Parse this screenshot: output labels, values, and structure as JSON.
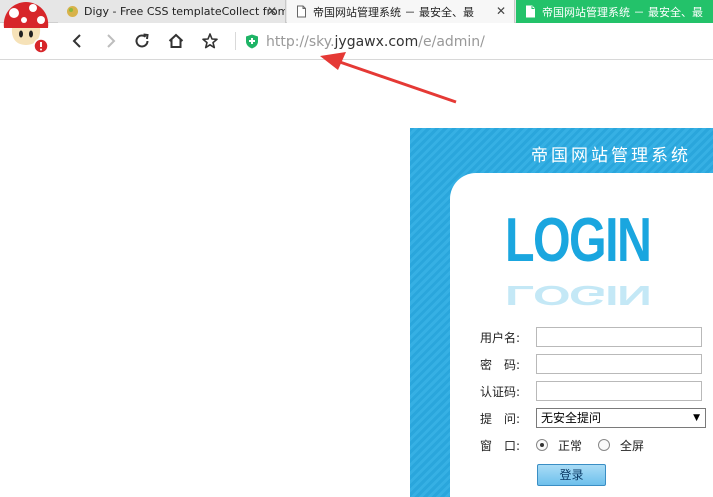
{
  "tabs": [
    {
      "title": "Digy - Free CSS templateCollect from",
      "close": "✕"
    },
    {
      "title": "帝国网站管理系统 － 最安全、最",
      "close": "✕"
    },
    {
      "title": "帝国网站管理系统 － 最安全、最",
      "close": ""
    }
  ],
  "toolbar": {
    "url_prefix": "http://sky.",
    "url_host": "jygawx.com",
    "url_path": "/e/admin/"
  },
  "login": {
    "panel_title": "帝国网站管理系统",
    "logo": "LOGIN",
    "fields": {
      "username_label": "用户名:",
      "password_label": "密　码:",
      "captcha_label": "认证码:",
      "question_label": "提　问:",
      "window_label": "窗　口:"
    },
    "question_selected": "无安全提问",
    "window_options": [
      "正常",
      "全屏"
    ],
    "window_selected": "正常",
    "submit_label": "登录"
  },
  "colors": {
    "panel_blue": "#2aa6dc",
    "logo_blue": "#1aa6df",
    "active_tab": "#23c26a",
    "arrow_red": "#e53935"
  }
}
